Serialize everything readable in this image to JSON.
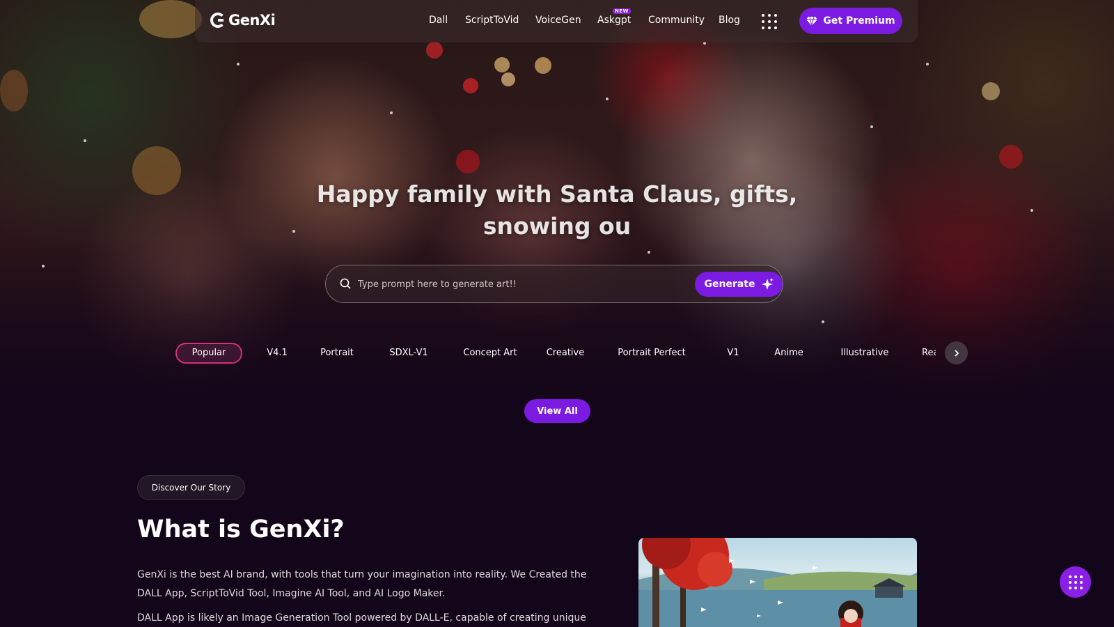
{
  "brand": {
    "name": "GenXi"
  },
  "nav": {
    "links": [
      "Dall",
      "ScriptToVid",
      "VoiceGen",
      "Askgpt",
      "Community",
      "Blog"
    ],
    "new_badge": "NEW",
    "premium_label": "Get Premium"
  },
  "hero": {
    "title": "Happy family with Santa Claus, gifts, snowing ou"
  },
  "search": {
    "placeholder": "Type prompt here to generate art!!",
    "value": "",
    "generate_label": "Generate"
  },
  "styles": {
    "tabs": [
      "Popular",
      "V4.1",
      "Portrait",
      "SDXL-V1",
      "Concept Art",
      "Creative",
      "Portrait Perfect",
      "V1",
      "Anime",
      "Illustrative",
      "Real"
    ],
    "active": "Popular",
    "view_all_label": "View All"
  },
  "about": {
    "badge": "Discover Our Story",
    "title": "What is GenXi?",
    "paragraph1": "GenXi is the best AI brand, with tools that turn your imagination into reality. We Created the DALL App, ScriptToVid Tool, Imagine AI Tool, and AI Logo Maker.",
    "paragraph2": "DALL App is likely an Image Generation Tool powered by DALL-E, capable of creating unique"
  },
  "colors": {
    "accent": "#7b1ae0",
    "active_tab_border": "#d0327a",
    "page_background": "#14061a"
  },
  "icons": [
    "logo-icon",
    "apps-grid-icon",
    "diamond-icon",
    "search-icon",
    "sparkle-icon",
    "chevron-right-icon",
    "apps-grid-icon"
  ]
}
